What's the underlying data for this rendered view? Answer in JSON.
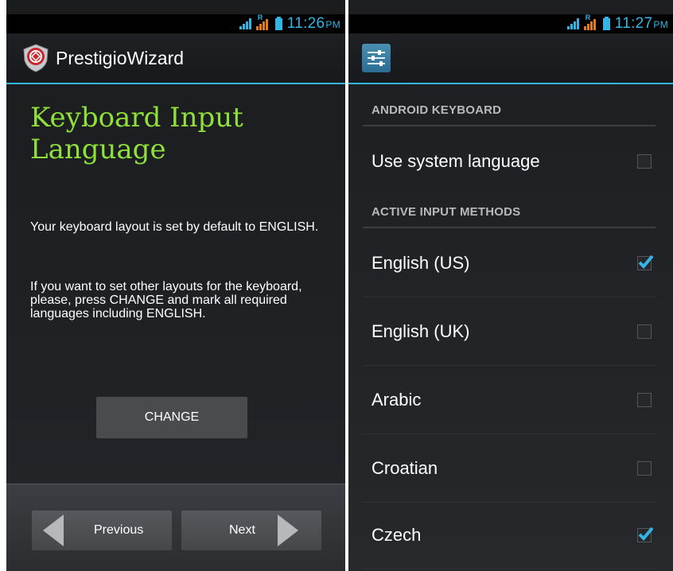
{
  "left": {
    "status_time": "11:26",
    "status_ampm": "PM",
    "app_title": "PrestigioWizard",
    "heading": "Keyboard Input Language",
    "paragraph1": "Your keyboard layout is set by default to ENGLISH.",
    "paragraph2": "If you want to set other layouts for the keyboard, please, press CHANGE and mark all required languages including ENGLISH.",
    "change_label": "CHANGE",
    "previous_label": "Previous",
    "next_label": "Next"
  },
  "right": {
    "status_time": "11:27",
    "status_ampm": "PM",
    "section1": "ANDROID KEYBOARD",
    "section2": "ACTIVE INPUT METHODS",
    "items": [
      {
        "label": "Use system language",
        "checked": false
      },
      {
        "label": "English (US)",
        "checked": true
      },
      {
        "label": "English (UK)",
        "checked": false
      },
      {
        "label": "Arabic",
        "checked": false
      },
      {
        "label": "Croatian",
        "checked": false
      },
      {
        "label": "Czech",
        "checked": true
      }
    ]
  },
  "colors": {
    "accent": "#33b5e5",
    "heading": "#8fe03a",
    "roaming": "#e27a1e"
  }
}
